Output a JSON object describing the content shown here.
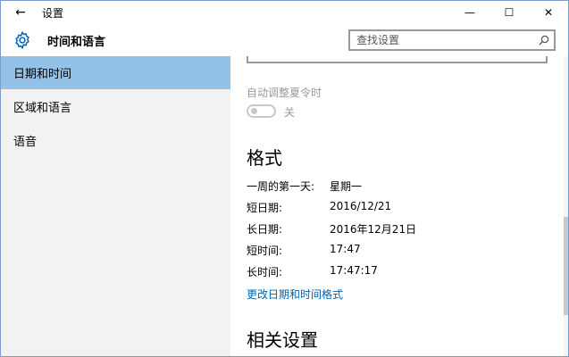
{
  "window": {
    "app_title": "设置",
    "controls": {
      "minimize": "—",
      "maximize": "☐",
      "close": "✕"
    }
  },
  "header": {
    "title": "时间和语言",
    "search_placeholder": "查找设置"
  },
  "sidebar": {
    "items": [
      {
        "label": "日期和时间",
        "active": true
      },
      {
        "label": "区域和语言",
        "active": false
      },
      {
        "label": "语音",
        "active": false
      }
    ]
  },
  "content": {
    "dst": {
      "label": "自动调整夏令时",
      "state": "关",
      "on": false
    },
    "format": {
      "title": "格式",
      "rows": [
        {
          "label": "一周的第一天:",
          "value": "星期一"
        },
        {
          "label": "短日期:",
          "value": "2016/12/21"
        },
        {
          "label": "长日期:",
          "value": "2016年12月21日"
        },
        {
          "label": "短时间:",
          "value": "17:47"
        },
        {
          "label": "长时间:",
          "value": "17:47:17"
        }
      ],
      "link": "更改日期和时间格式"
    },
    "related": {
      "title": "相关设置"
    }
  },
  "colors": {
    "accent": "#0063b1",
    "nav_selected": "#94c1e6",
    "sidebar_bg": "#f2f2f2"
  }
}
